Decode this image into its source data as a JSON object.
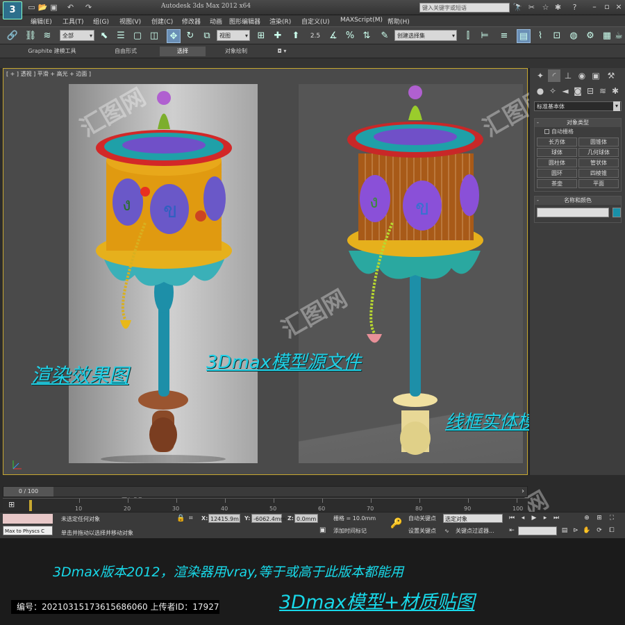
{
  "window": {
    "title": "Autodesk 3ds Max  2012 x64",
    "logo": "3",
    "search_placeholder": "键入关键字或短语"
  },
  "menu": [
    "编辑(E)",
    "工具(T)",
    "组(G)",
    "视图(V)",
    "创建(C)",
    "修改器",
    "动画",
    "图形编辑器",
    "渲染(R)",
    "自定义(U)",
    "MAXScript(M)",
    "帮助(H)"
  ],
  "toolbar": {
    "selection_filter": "全部",
    "reference_coord": "视图",
    "snap_value": "2.5",
    "named_selection": "创建选择集"
  },
  "ribbon": {
    "tabs": [
      "Graphite 建模工具",
      "自由形式",
      "选择",
      "对象绘制"
    ],
    "active_tab": "选择"
  },
  "viewport": {
    "label": "[ + ] 透视 ] 平滑 + 高光 + 边面 ]",
    "overlays": {
      "render_label": "渲染效果图",
      "source_label": "3Dmax模型源文件",
      "wire_label": "线框实体模式"
    }
  },
  "command_panel": {
    "dropdown": "标准基本体",
    "object_type_title": "对象类型",
    "auto_grid": "自动栅格",
    "objects": [
      "长方体",
      "圆锥体",
      "球体",
      "几何球体",
      "圆柱体",
      "管状体",
      "圆环",
      "四棱锥",
      "茶壶",
      "平面"
    ],
    "name_color_title": "名称和颜色",
    "swatch_color": "#1990a8"
  },
  "timeline": {
    "position": "0 / 100",
    "ticks": [
      "10",
      "20",
      "30",
      "40",
      "50",
      "60",
      "70",
      "80",
      "90",
      "100"
    ]
  },
  "status": {
    "max_physx": "Max to Physcs C",
    "selection_text": "未选定任何对象",
    "prompt_text": "单击并拖动以选择并移动对象",
    "x_label": "X:",
    "x_value": "12415.9m",
    "y_label": "Y:",
    "y_value": "-6062.4mm",
    "z_label": "Z:",
    "z_value": "0.0mm",
    "grid": "栅格 = 10.0mm",
    "add_time_tag": "添加时间标记",
    "auto_key": "自动关键点",
    "set_key": "设置关键点",
    "selected_object": "选定对象",
    "key_filters": "关键点过滤器..."
  },
  "captions": {
    "line1": "3Dmax版本2012，渲染器用vray,等于或高于此版本都能用",
    "line2": "3Dmax模型+材质贴图",
    "id_line": "编号：20210315173615686060 上传者ID：17927"
  },
  "watermark": "汇图网",
  "colors": {
    "accent_cyan": "#18d8e8",
    "viewport_border": "#c8a830",
    "render_swatch": "#1990a8"
  }
}
